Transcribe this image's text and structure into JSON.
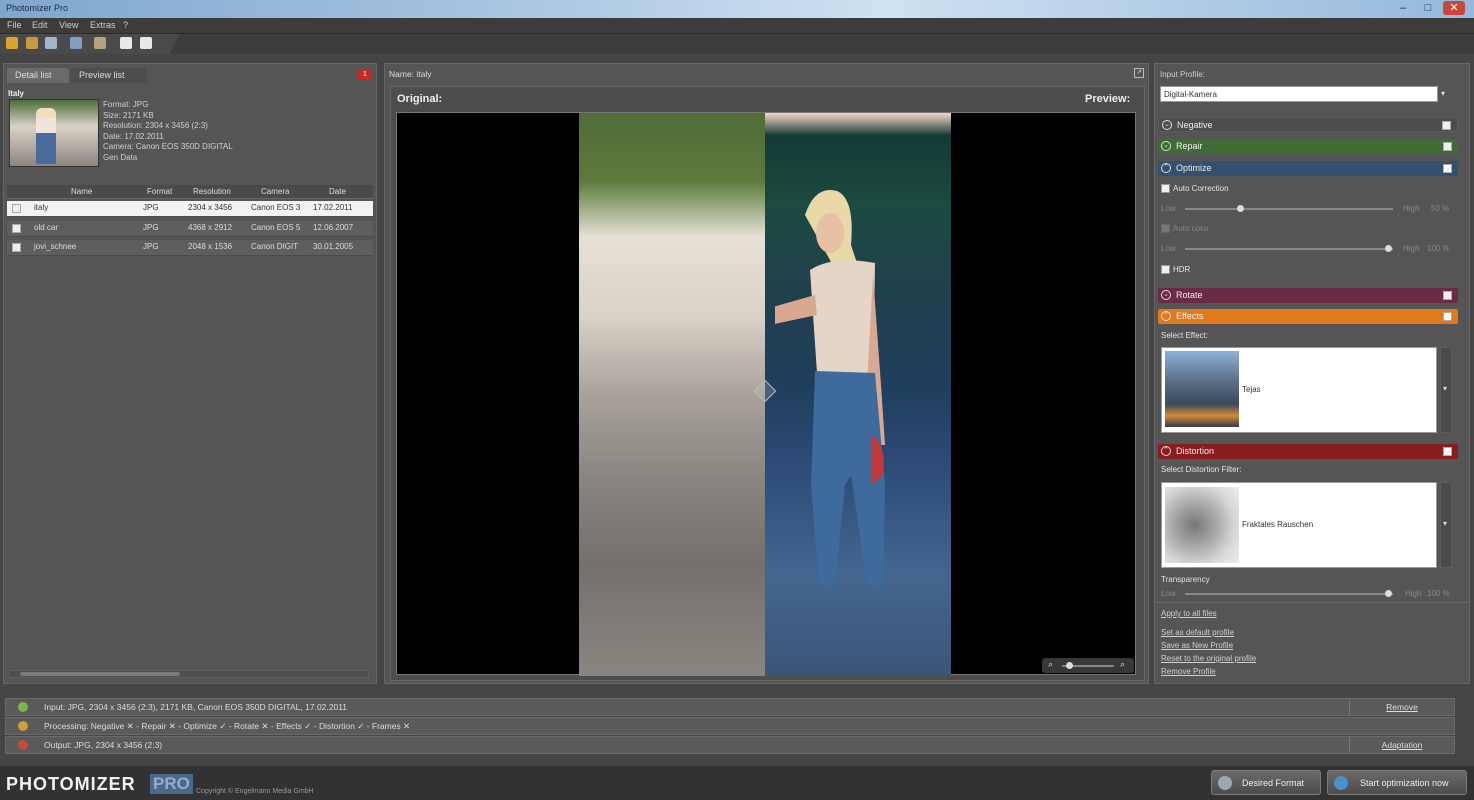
{
  "window": {
    "title": "Photomizer Pro"
  },
  "menu": [
    "File",
    "Edit",
    "View",
    "Extras",
    "?"
  ],
  "left": {
    "tabs": [
      "Detail list",
      "Preview list"
    ],
    "badge": "1",
    "selected_name": "Italy",
    "info": [
      "Format: JPG",
      "Size: 2171 KB",
      "Resolution: 2304 x 3456 (2:3)",
      "Date: 17.02.2011",
      "Camera: Canon EOS 350D DIGITAL",
      "Gen Data"
    ],
    "headers": [
      "Name",
      "Format",
      "Resolution",
      "Camera",
      "Date"
    ],
    "rows": [
      {
        "name": "italy",
        "format": "JPG",
        "resolution": "2304 x 3456",
        "camera": "Canon EOS 3",
        "date": "17.02.2011"
      },
      {
        "name": "old car",
        "format": "JPG",
        "resolution": "4368 x 2912",
        "camera": "Canon EOS 5",
        "date": "12.06.2007"
      },
      {
        "name": "jovi_schnee",
        "format": "JPG",
        "resolution": "2048 x 1536",
        "camera": "Canon DIGIT",
        "date": "30.01.2005"
      }
    ]
  },
  "center": {
    "name_label": "Name: italy",
    "original": "Original:",
    "preview": "Preview:"
  },
  "right": {
    "profile_label": "Input Profile:",
    "profile_value": "Digital-Kamera",
    "sections": {
      "negative": "Negative",
      "repair": "Repair",
      "optimize": "Optimize",
      "rotate": "Rotate",
      "effects": "Effects",
      "distortion": "Distortion"
    },
    "auto_correction": "Auto Correction",
    "auto_color": "Auto color",
    "hdr": "HDR",
    "low": "Low",
    "high1": "High",
    "pct1": "50 %",
    "high2": "High",
    "pct2": "100 %",
    "select_effect": "Select Effect:",
    "effect_name": "Tejas",
    "select_distortion": "Select Distortion Filter:",
    "distortion_name": "Fraktales Rauschen",
    "transparency": "Transparency",
    "tr_low": "Low",
    "tr_high": "High",
    "tr_pct": "100 %",
    "links": [
      "Apply to all files",
      "Set as default profile",
      "Save as New Profile",
      "Reset to the original profile",
      "Remove Profile"
    ]
  },
  "status": {
    "input": "Input: JPG, 2304 x 3456 (2:3), 2171 KB, Canon EOS 350D DIGITAL, 17.02.2011",
    "processing": "Processing: Negative ✕ - Repair ✕ - Optimize ✓ - Rotate ✕ - Effects ✓ - Distortion ✓ - Frames ✕",
    "output": "Output: JPG, 2304 x 3456 (2:3)",
    "remove": "Remove",
    "adaptation": "Adaptation"
  },
  "footer": {
    "logo": "PHOTOMIZER",
    "logo_pro": "PRO",
    "copyright": "Copyright © Engelmann Media GmbH",
    "desired_format": "Desired Format",
    "start": "Start optimization now"
  },
  "colors": {
    "repair": "#3f6b35",
    "optimize": "#34506f",
    "rotate": "#6b2a45",
    "effects": "#e07a1c",
    "distortion": "#8a1b1e"
  }
}
